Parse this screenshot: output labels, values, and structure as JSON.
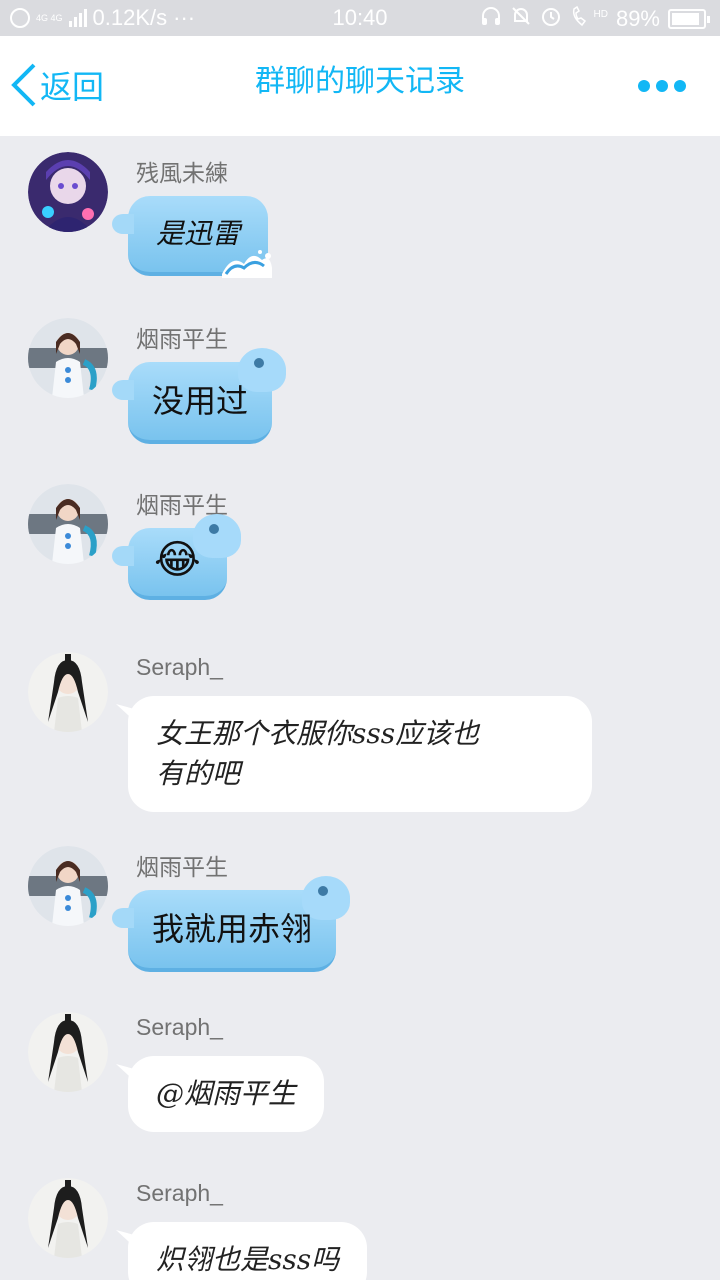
{
  "status": {
    "speed": "0.12K/s",
    "dots": "···",
    "network": "4G 4G",
    "time": "10:40",
    "battery": "89%",
    "battery_level": 0.89,
    "hd": "HD"
  },
  "header": {
    "back_label": "返回",
    "title": "群聊的聊天记录"
  },
  "messages": [
    {
      "sender": "残風未練",
      "text": "是迅雷",
      "style": "blue-wave"
    },
    {
      "sender": "烟雨平生",
      "text": "没用过",
      "style": "blue-hippo"
    },
    {
      "sender": "烟雨平生",
      "text": "😂",
      "style": "blue-hippo"
    },
    {
      "sender": "Seraph_",
      "text_line1": "女王那个衣服你sss应该也",
      "text_line2": "有的吧",
      "style": "white"
    },
    {
      "sender": "烟雨平生",
      "text": "我就用赤翎",
      "style": "blue-hippo"
    },
    {
      "sender": "Seraph_",
      "text": "@烟雨平生",
      "style": "white"
    },
    {
      "sender": "Seraph_",
      "text": "炽翎也是sss吗",
      "style": "white"
    }
  ]
}
